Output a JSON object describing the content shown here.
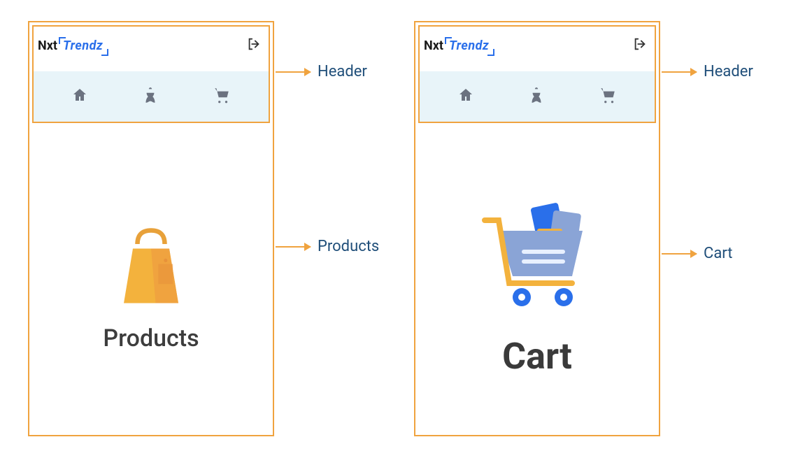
{
  "logo": {
    "part1": "Nxt",
    "part2": "Trendz"
  },
  "annotations": {
    "header": "Header",
    "products": "Products",
    "cart": "Cart"
  },
  "screens": {
    "products": {
      "title": "Products"
    },
    "cart": {
      "title": "Cart"
    }
  },
  "icons": {
    "logout": "logout-icon",
    "home": "home-icon",
    "products": "products-icon",
    "cart": "cart-icon"
  }
}
